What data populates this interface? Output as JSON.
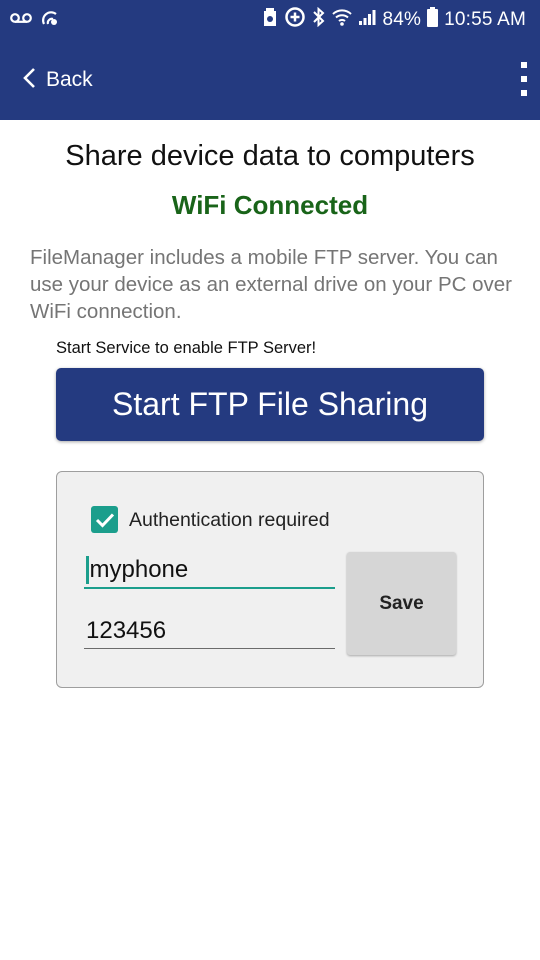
{
  "status_bar": {
    "battery_percent": "84%",
    "time": "10:55 AM",
    "icons": [
      "voicemail-icon",
      "hotspot-icon",
      "clean-storage-icon",
      "data-saver-icon",
      "bluetooth-icon",
      "wifi-icon",
      "cell-signal-icon",
      "battery-icon"
    ]
  },
  "app_bar": {
    "back_label": "Back",
    "menu_icon": "more-vert-icon",
    "color": "#243a80"
  },
  "main": {
    "title": "Share device data to computers",
    "wifi_status": "WiFi Connected",
    "wifi_status_color": "#196419",
    "description": "FileManager includes a mobile FTP server. You can use your device as an external drive on your PC over WiFi connection.",
    "hint": "Start Service to enable FTP Server!",
    "start_button_label": "Start FTP File Sharing"
  },
  "auth": {
    "checked": true,
    "checkbox_label": "Authentication required",
    "username": "myphone",
    "password": "123456",
    "save_label": "Save",
    "accent": "#1b9e8c"
  }
}
